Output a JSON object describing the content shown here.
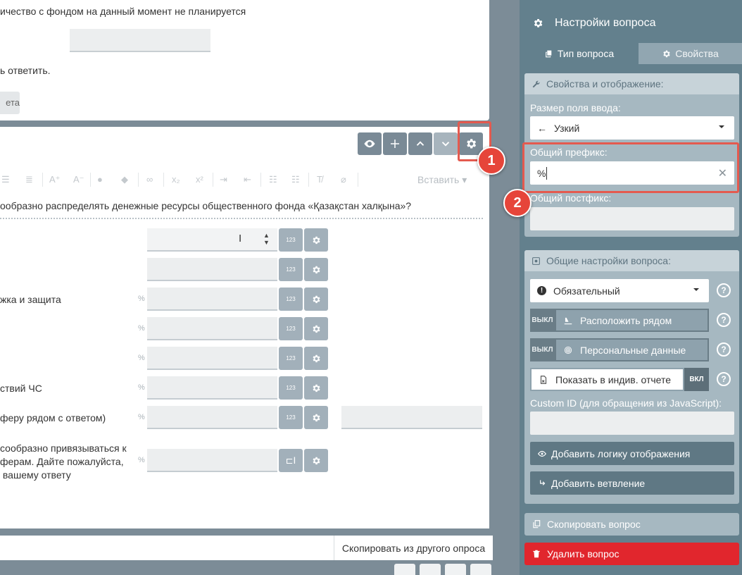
{
  "canvas": {
    "prev_question": {
      "text_line1": "ичество с фондом на данный момент не планируется",
      "text_line2": "ь ответить.",
      "button_partial": "ета"
    },
    "question_toolbar": {
      "icons": [
        "eye-icon",
        "plus-icon",
        "chevron-up-icon",
        "chevron-down-icon",
        "gear-icon"
      ]
    },
    "rte": {
      "insert_label": "Вставить"
    },
    "question_title": "ообразно распределять денежные ресурсы общественного фонда «Қазақстан халқына»?",
    "rows": [
      {
        "label": "",
        "prefix": "",
        "type": "number"
      },
      {
        "label": "",
        "prefix": "",
        "type": "number"
      },
      {
        "label": "жка и защита",
        "prefix": "%",
        "type": "number"
      },
      {
        "label": "",
        "prefix": "%",
        "type": "number"
      },
      {
        "label": "",
        "prefix": "%",
        "type": "number"
      },
      {
        "label": "ствий ЧС",
        "prefix": "%",
        "type": "number"
      },
      {
        "label": "феру рядом с ответом)",
        "prefix": "%",
        "type": "number"
      },
      {
        "label": "сообразно привязываться к\nферам. Дайте пожалуйста,\n вашему ответу",
        "prefix": "%",
        "type": "text"
      }
    ],
    "number_badge": "123",
    "copy_from_other": "Скопировать из другого опроса"
  },
  "callouts": {
    "badge1": "1",
    "badge2": "2"
  },
  "panel": {
    "title": "Настройки вопроса",
    "tabs": {
      "type": "Тип вопроса",
      "properties": "Свойства"
    },
    "props_section": {
      "header": "Свойства и отображение:",
      "input_size_label": "Размер поля ввода:",
      "input_size_value": "Узкий",
      "prefix_label": "Общий префикс:",
      "prefix_value": "%",
      "postfix_label": "Общий постфикс:",
      "postfix_value": ""
    },
    "general_section": {
      "header": "Общие настройки вопроса:",
      "required_value": "Обязательный",
      "toggle_off": "ВЫКЛ",
      "toggle_on": "ВКЛ",
      "side_by_side": "Расположить рядом",
      "personal_data": "Персональные данные",
      "show_in_report": "Показать в индив. отчете",
      "custom_id_label": "Custom ID (для обращения из JavaScript):",
      "custom_id_value": "",
      "add_display_logic": "Добавить логику отображения",
      "add_branching": "Добавить ветвление"
    },
    "copy_question": "Скопировать вопрос",
    "delete_question": "Удалить вопрос",
    "help_glyph": "?"
  },
  "colors": {
    "panel_bg": "#63808d",
    "highlight": "#e45a4f",
    "delete_red": "#e1262d"
  }
}
